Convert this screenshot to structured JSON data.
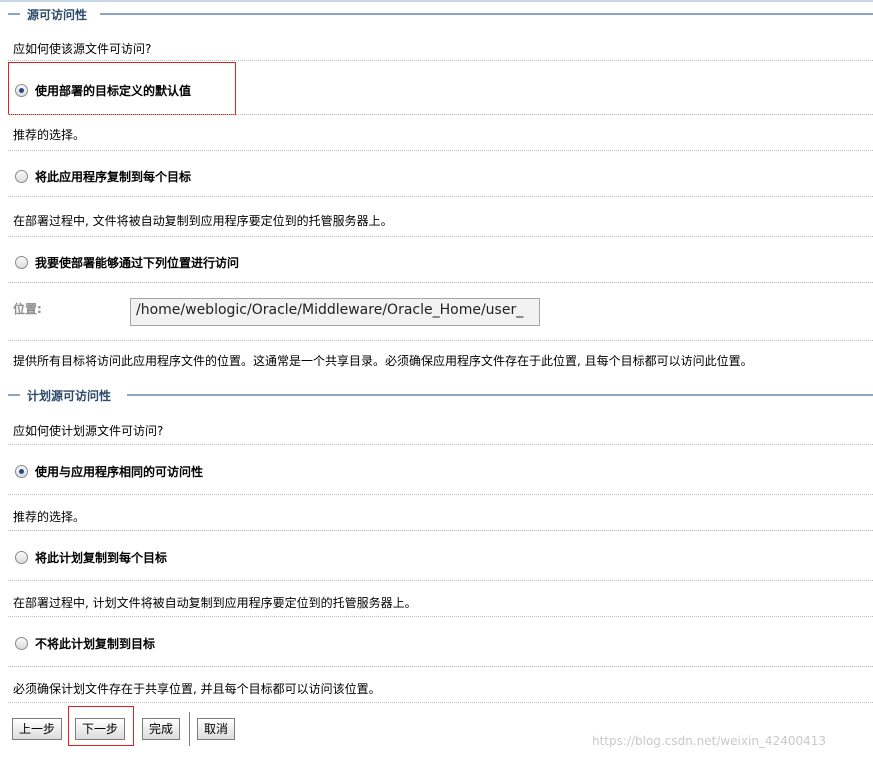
{
  "source_section": {
    "title": "源可访问性",
    "question": "应如何使该源文件可访问?",
    "options": [
      {
        "label": "使用部署的目标定义的默认值",
        "selected": true,
        "note": "推荐的选择。"
      },
      {
        "label": "将此应用程序复制到每个目标",
        "selected": false,
        "note": "在部署过程中, 文件将被自动复制到应用程序要定位到的托管服务器上。"
      },
      {
        "label": "我要使部署能够通过下列位置进行访问",
        "selected": false
      }
    ],
    "location_label": "位置:",
    "location_value": "/home/weblogic/Oracle/Middleware/Oracle_Home/user_",
    "location_note": "提供所有目标将访问此应用程序文件的位置。这通常是一个共享目录。必须确保应用程序文件存在于此位置, 且每个目标都可以访问此位置。"
  },
  "plan_section": {
    "title": "计划源可访问性",
    "question": "应如何使计划源文件可访问?",
    "options": [
      {
        "label": "使用与应用程序相同的可访问性",
        "selected": true,
        "note": "推荐的选择。"
      },
      {
        "label": "将此计划复制到每个目标",
        "selected": false,
        "note": "在部署过程中, 计划文件将被自动复制到应用程序要定位到的托管服务器上。"
      },
      {
        "label": "不将此计划复制到目标",
        "selected": false,
        "note": "必须确保计划文件存在于共享位置, 并且每个目标都可以访问该位置。"
      }
    ]
  },
  "buttons": {
    "back": "上一步",
    "next": "下一步",
    "finish": "完成",
    "cancel": "取消"
  },
  "watermark": "https://blog.csdn.net/weixin_42400413"
}
